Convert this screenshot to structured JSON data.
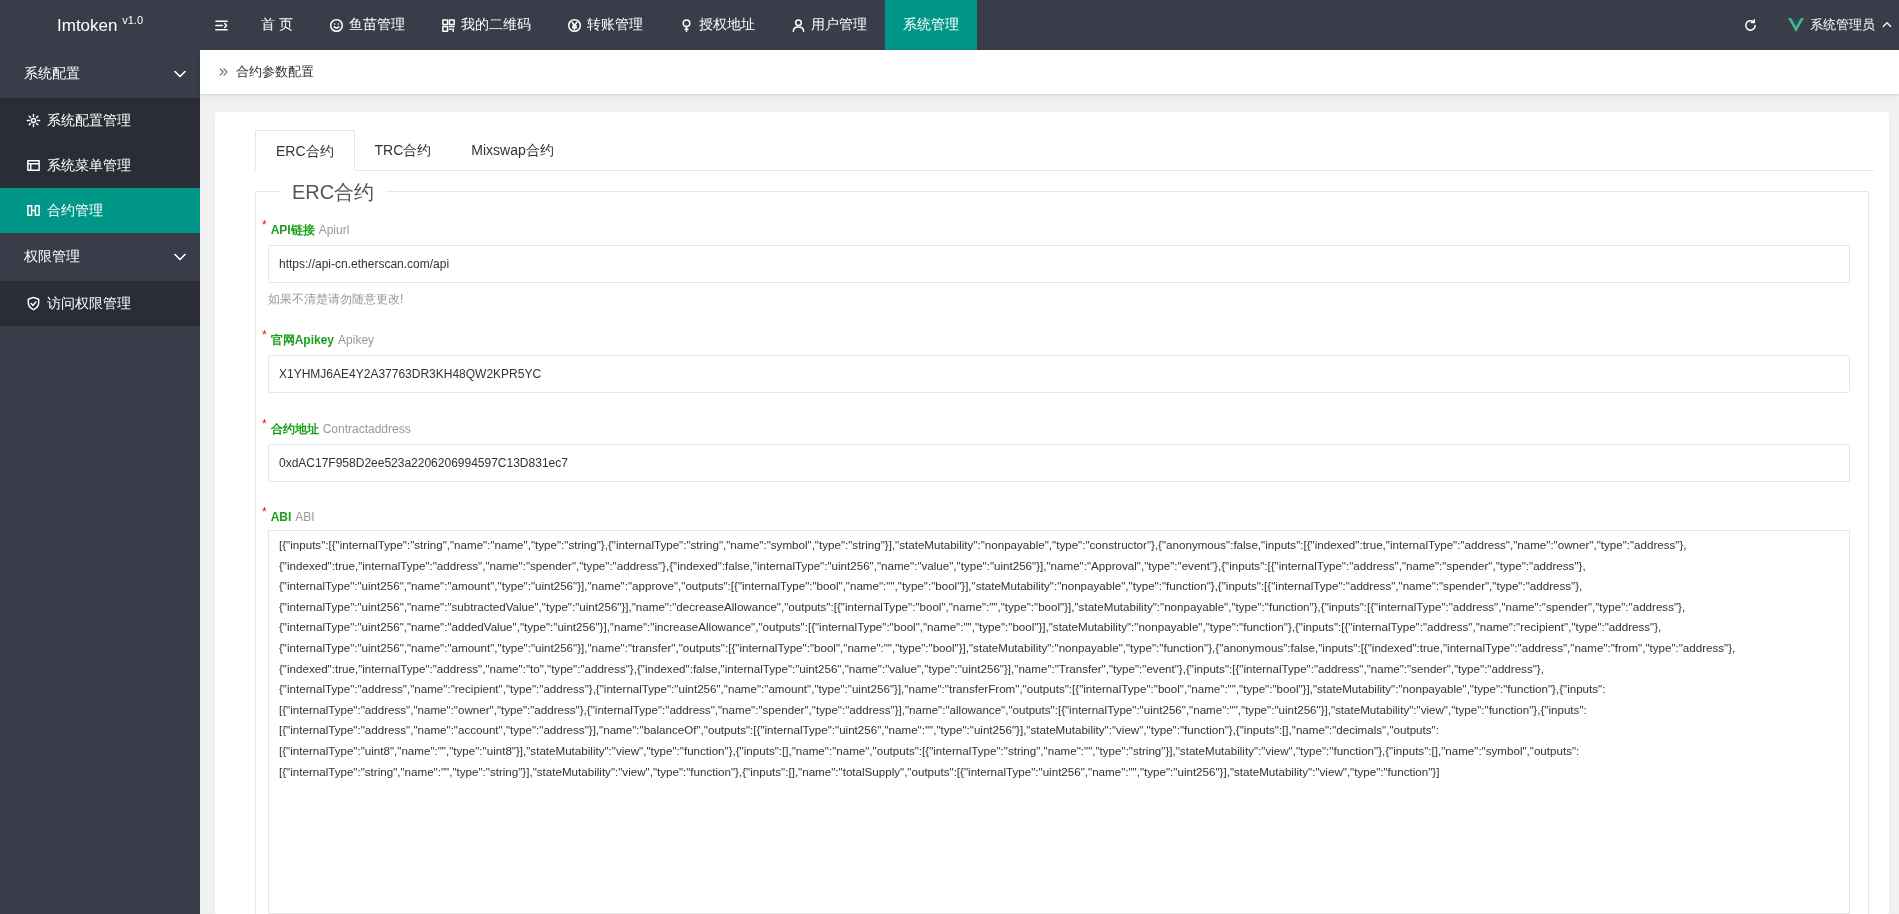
{
  "app": {
    "name": "Imtoken",
    "version": "v1.0"
  },
  "nav": [
    {
      "label": "首 页",
      "selected": false
    },
    {
      "label": "鱼苗管理",
      "selected": false
    },
    {
      "label": "我的二维码",
      "selected": false
    },
    {
      "label": "转账管理",
      "selected": false
    },
    {
      "label": "授权地址",
      "selected": false
    },
    {
      "label": "用户管理",
      "selected": false
    },
    {
      "label": "系统管理",
      "selected": true
    }
  ],
  "user": {
    "name": "系统管理员"
  },
  "sidebar": {
    "groups": [
      {
        "label": "系统配置",
        "expanded": true,
        "children": [
          {
            "label": "系统配置管理",
            "selected": false
          },
          {
            "label": "系统菜单管理",
            "selected": false
          },
          {
            "label": "合约管理",
            "selected": true
          }
        ]
      },
      {
        "label": "权限管理",
        "expanded": true,
        "children": [
          {
            "label": "访问权限管理",
            "selected": false
          }
        ]
      }
    ]
  },
  "breadcrumb": "合约参数配置",
  "tabs": [
    {
      "label": "ERC合约",
      "selected": true
    },
    {
      "label": "TRC合约",
      "selected": false
    },
    {
      "label": "Mixswap合约",
      "selected": false
    }
  ],
  "form": {
    "legend": "ERC合约",
    "fields": [
      {
        "kind": "input",
        "required_mark": "*",
        "label": "API链接",
        "sublabel": "Apiurl",
        "value": "https://api-cn.etherscan.com/api",
        "hint": "如果不清楚请勿随意更改!"
      },
      {
        "kind": "input",
        "required_mark": "*",
        "label": "官网Apikey",
        "sublabel": "Apikey",
        "value": "X1YHMJ6AE4Y2A37763DR3KH48QW2KPR5YC"
      },
      {
        "kind": "input",
        "required_mark": "*",
        "label": "合约地址",
        "sublabel": "Contractaddress",
        "value": "0xdAC17F958D2ee523a2206206994597C13D831ec7"
      },
      {
        "kind": "textarea",
        "required_mark": "*",
        "label": "ABI",
        "sublabel": "ABI",
        "value": "[{\"inputs\":[{\"internalType\":\"string\",\"name\":\"name\",\"type\":\"string\"},{\"internalType\":\"string\",\"name\":\"symbol\",\"type\":\"string\"}],\"stateMutability\":\"nonpayable\",\"type\":\"constructor\"},{\"anonymous\":false,\"inputs\":[{\"indexed\":true,\"internalType\":\"address\",\"name\":\"owner\",\"type\":\"address\"},{\"indexed\":true,\"internalType\":\"address\",\"name\":\"spender\",\"type\":\"address\"},{\"indexed\":false,\"internalType\":\"uint256\",\"name\":\"value\",\"type\":\"uint256\"}],\"name\":\"Approval\",\"type\":\"event\"},{\"inputs\":[{\"internalType\":\"address\",\"name\":\"spender\",\"type\":\"address\"},{\"internalType\":\"uint256\",\"name\":\"amount\",\"type\":\"uint256\"}],\"name\":\"approve\",\"outputs\":[{\"internalType\":\"bool\",\"name\":\"\",\"type\":\"bool\"}],\"stateMutability\":\"nonpayable\",\"type\":\"function\"},{\"inputs\":[{\"internalType\":\"address\",\"name\":\"spender\",\"type\":\"address\"},{\"internalType\":\"uint256\",\"name\":\"subtractedValue\",\"type\":\"uint256\"}],\"name\":\"decreaseAllowance\",\"outputs\":[{\"internalType\":\"bool\",\"name\":\"\",\"type\":\"bool\"}],\"stateMutability\":\"nonpayable\",\"type\":\"function\"},{\"inputs\":[{\"internalType\":\"address\",\"name\":\"spender\",\"type\":\"address\"},{\"internalType\":\"uint256\",\"name\":\"addedValue\",\"type\":\"uint256\"}],\"name\":\"increaseAllowance\",\"outputs\":[{\"internalType\":\"bool\",\"name\":\"\",\"type\":\"bool\"}],\"stateMutability\":\"nonpayable\",\"type\":\"function\"},{\"inputs\":[{\"internalType\":\"address\",\"name\":\"recipient\",\"type\":\"address\"},{\"internalType\":\"uint256\",\"name\":\"amount\",\"type\":\"uint256\"}],\"name\":\"transfer\",\"outputs\":[{\"internalType\":\"bool\",\"name\":\"\",\"type\":\"bool\"}],\"stateMutability\":\"nonpayable\",\"type\":\"function\"},{\"anonymous\":false,\"inputs\":[{\"indexed\":true,\"internalType\":\"address\",\"name\":\"from\",\"type\":\"address\"},{\"indexed\":true,\"internalType\":\"address\",\"name\":\"to\",\"type\":\"address\"},{\"indexed\":false,\"internalType\":\"uint256\",\"name\":\"value\",\"type\":\"uint256\"}],\"name\":\"Transfer\",\"type\":\"event\"},{\"inputs\":[{\"internalType\":\"address\",\"name\":\"sender\",\"type\":\"address\"},{\"internalType\":\"address\",\"name\":\"recipient\",\"type\":\"address\"},{\"internalType\":\"uint256\",\"name\":\"amount\",\"type\":\"uint256\"}],\"name\":\"transferFrom\",\"outputs\":[{\"internalType\":\"bool\",\"name\":\"\",\"type\":\"bool\"}],\"stateMutability\":\"nonpayable\",\"type\":\"function\"},{\"inputs\":[{\"internalType\":\"address\",\"name\":\"owner\",\"type\":\"address\"},{\"internalType\":\"address\",\"name\":\"spender\",\"type\":\"address\"}],\"name\":\"allowance\",\"outputs\":[{\"internalType\":\"uint256\",\"name\":\"\",\"type\":\"uint256\"}],\"stateMutability\":\"view\",\"type\":\"function\"},{\"inputs\":[{\"internalType\":\"address\",\"name\":\"account\",\"type\":\"address\"}],\"name\":\"balanceOf\",\"outputs\":[{\"internalType\":\"uint256\",\"name\":\"\",\"type\":\"uint256\"}],\"stateMutability\":\"view\",\"type\":\"function\"},{\"inputs\":[],\"name\":\"decimals\",\"outputs\":[{\"internalType\":\"uint8\",\"name\":\"\",\"type\":\"uint8\"}],\"stateMutability\":\"view\",\"type\":\"function\"},{\"inputs\":[],\"name\":\"name\",\"outputs\":[{\"internalType\":\"string\",\"name\":\"\",\"type\":\"string\"}],\"stateMutability\":\"view\",\"type\":\"function\"},{\"inputs\":[],\"name\":\"symbol\",\"outputs\":[{\"internalType\":\"string\",\"name\":\"\",\"type\":\"string\"}],\"stateMutability\":\"view\",\"type\":\"function\"},{\"inputs\":[],\"name\":\"totalSupply\",\"outputs\":[{\"internalType\":\"uint256\",\"name\":\"\",\"type\":\"uint256\"}],\"stateMutability\":\"view\",\"type\":\"function\"}]"
      }
    ]
  }
}
